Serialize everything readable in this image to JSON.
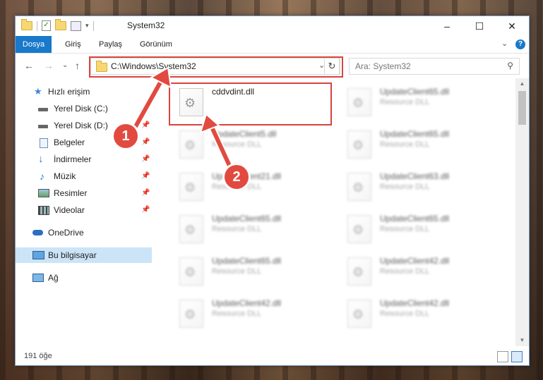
{
  "window": {
    "title": "System32",
    "controls": {
      "minimize": "–",
      "maximize": "☐",
      "close": "✕"
    }
  },
  "ribbon": {
    "tabs": [
      "Dosya",
      "Giriş",
      "Paylaş",
      "Görünüm"
    ],
    "active_tab": "Dosya",
    "help": "?",
    "expand": "⌄"
  },
  "navigation": {
    "back": "←",
    "forward": "→",
    "recent": "⌄",
    "up": "↑",
    "address": "C:\\Windows\\System32",
    "address_dropdown": "⌄",
    "refresh": "↻",
    "search_placeholder": "Ara: System32",
    "search_icon": "🔍"
  },
  "sidebar": {
    "items": [
      {
        "label": "Hızlı erişim",
        "icon": "star-icon",
        "pinned": false
      },
      {
        "label": "Yerel Disk (C:)",
        "icon": "drive-icon",
        "pinned": true
      },
      {
        "label": "Yerel Disk (D:)",
        "icon": "drive-icon",
        "pinned": true
      },
      {
        "label": "Belgeler",
        "icon": "documents-icon",
        "pinned": true
      },
      {
        "label": "İndirmeler",
        "icon": "download-icon",
        "pinned": true
      },
      {
        "label": "Müzik",
        "icon": "music-icon",
        "pinned": true
      },
      {
        "label": "Resimler",
        "icon": "pictures-icon",
        "pinned": true
      },
      {
        "label": "Videolar",
        "icon": "videos-icon",
        "pinned": true
      },
      {
        "label": "OneDrive",
        "icon": "cloud-icon",
        "pinned": false
      },
      {
        "label": "Bu bilgisayar",
        "icon": "computer-icon",
        "pinned": false,
        "selected": true
      },
      {
        "label": "Ağ",
        "icon": "network-icon",
        "pinned": false
      }
    ],
    "pin_glyph": "📌"
  },
  "files": [
    {
      "name": "cddvdint.dll",
      "type": ""
    },
    {
      "name": "UpdateClient65.dll",
      "type": "Resource DLL"
    },
    {
      "name": "UpdateClient5.dll",
      "type": "Resource DLL"
    },
    {
      "name": "UpdateClient65.dll",
      "type": "Resource DLL"
    },
    {
      "name": "UpdateClient21.dll",
      "type": "Resource DLL"
    },
    {
      "name": "UpdateClient63.dll",
      "type": "Resource DLL"
    },
    {
      "name": "UpdateClient65.dll",
      "type": "Resource DLL"
    },
    {
      "name": "UpdateClient65.dll",
      "type": "Resource DLL"
    },
    {
      "name": "UpdateClient65.dll",
      "type": "Resource DLL"
    },
    {
      "name": "UpdateClient42.dll",
      "type": "Resource DLL"
    },
    {
      "name": "UpdateClient42.dll",
      "type": "Resource DLL"
    },
    {
      "name": "UpdateClient42.dll",
      "type": "Resource DLL"
    }
  ],
  "status": {
    "item_count": "191 öğe"
  },
  "callouts": [
    "1",
    "2"
  ],
  "colors": {
    "accent": "#1979ca",
    "callout": "#e24a3f",
    "selection": "#cce4f7"
  }
}
